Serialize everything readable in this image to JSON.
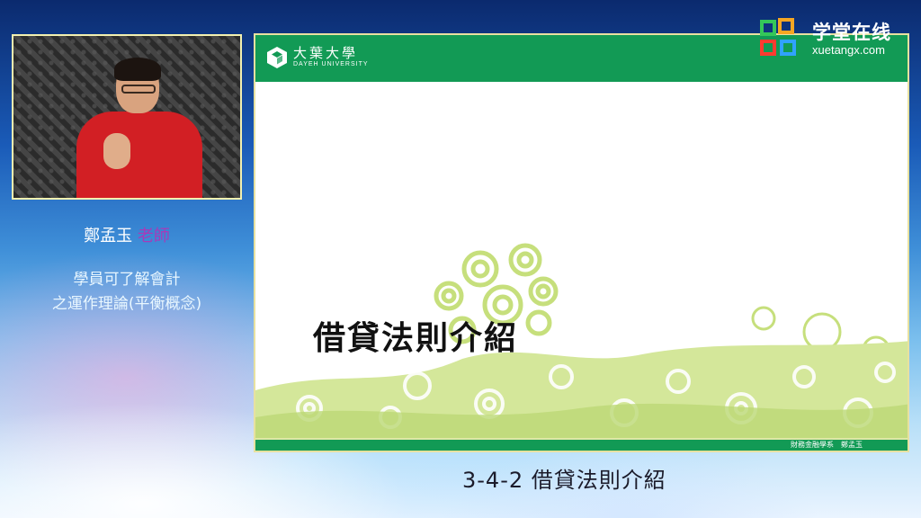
{
  "teacher": {
    "name": "鄭孟玉",
    "title": "老師"
  },
  "learning_goal": {
    "line1": "學員可了解會計",
    "line2": "之運作理論(平衡概念)"
  },
  "slide": {
    "logo_cn": "大葉大學",
    "logo_en": "DAYEH UNIVERSITY",
    "title": "借貸法則介紹",
    "footer": "財務金融學系　鄭孟玉",
    "colors": {
      "header": "#129a55",
      "swirl": "#c6df7c"
    }
  },
  "caption": "3-4-2  借貸法則介紹",
  "watermark": {
    "cn": "学堂在线",
    "en": "xuetangx.com"
  }
}
